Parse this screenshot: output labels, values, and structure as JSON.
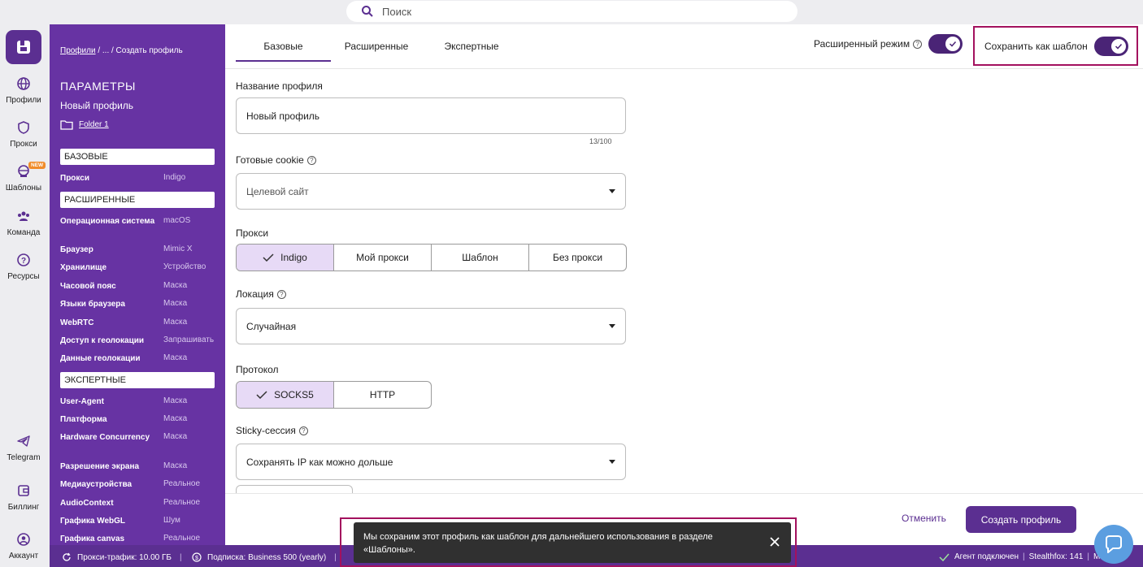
{
  "search": {
    "placeholder": "Поиск"
  },
  "nav": {
    "items": [
      {
        "label": "Профили"
      },
      {
        "label": "Прокси"
      },
      {
        "label": "Шаблоны",
        "badge": "NEW"
      },
      {
        "label": "Команда"
      },
      {
        "label": "Ресурсы"
      },
      {
        "label": "Telegram"
      },
      {
        "label": "Биллинг"
      },
      {
        "label": "Аккаунт"
      }
    ]
  },
  "params": {
    "breadcrumb_link": "Профили",
    "breadcrumb_rest": " / ... / Создать профиль",
    "title": "ПАРАМЕТРЫ",
    "profile_name": "Новый профиль",
    "folder": "Folder 1",
    "sections": {
      "basic": "БАЗОВЫЕ",
      "advanced": "РАСШИРЕННЫЕ",
      "expert": "ЭКСПЕРТНЫЕ"
    },
    "basic_rows": [
      {
        "k": "Прокси",
        "v": "Indigo"
      }
    ],
    "advanced_rows": [
      {
        "k": "Операционная система",
        "v": "macOS"
      },
      {
        "k": "Браузер",
        "v": "Mimic X"
      },
      {
        "k": "Хранилище",
        "v": "Устройство"
      },
      {
        "k": "Часовой пояс",
        "v": "Маска"
      },
      {
        "k": "Языки браузера",
        "v": "Маска"
      },
      {
        "k": "WebRTC",
        "v": "Маска"
      },
      {
        "k": "Доступ к геолокации",
        "v": "Запрашивать"
      },
      {
        "k": "Данные геолокации",
        "v": "Маска"
      }
    ],
    "expert_rows": [
      {
        "k": "User-Agent",
        "v": "Маска"
      },
      {
        "k": "Платформа",
        "v": "Маска"
      },
      {
        "k": "Hardware Concurrency",
        "v": "Маска"
      },
      {
        "k": "Разрешение экрана",
        "v": "Маска"
      },
      {
        "k": "Медиаустройства",
        "v": "Реальное"
      },
      {
        "k": "AudioContext",
        "v": "Реальное"
      },
      {
        "k": "Графика WebGL",
        "v": "Шум"
      },
      {
        "k": "Графика canvas",
        "v": "Реальное"
      }
    ]
  },
  "tabs": [
    "Базовые",
    "Расширенные",
    "Экспертные"
  ],
  "advanced_mode": {
    "label": "Расширенный режим",
    "on": true
  },
  "save_template": {
    "label": "Сохранить как шаблон",
    "on": true
  },
  "form": {
    "name_label": "Название профиля",
    "name_value": "Новый профиль",
    "name_counter": "13/100",
    "cookie_label": "Готовые cookie",
    "cookie_placeholder": "Целевой сайт",
    "proxy_label": "Прокси",
    "proxy_options": [
      "Indigo",
      "Мой прокси",
      "Шаблон",
      "Без прокси"
    ],
    "proxy_selected": "Indigo",
    "location_label": "Локация",
    "location_value": "Случайная",
    "protocol_label": "Протокол",
    "protocol_options": [
      "SOCKS5",
      "HTTP"
    ],
    "protocol_selected": "SOCKS5",
    "sticky_label": "Sticky-сессия",
    "sticky_value": "Сохранять IP как можно дольше"
  },
  "actions": {
    "cancel": "Отменить",
    "create": "Создать профиль"
  },
  "status": {
    "proxy_traffic": "Прокси-трафик: 10.00 ГБ",
    "subscription": "Подписка: Business 500 (yearly)",
    "agent": "Агент подключен",
    "stealthfox": "Stealthfox: 141",
    "mimic": "M"
  },
  "toast": {
    "text": "Мы сохраним этот профиль как шаблон для дальнейшего использования в разделе «Шаблоны»."
  },
  "colors": {
    "brand": "#5b2f91",
    "panel": "#6733a3",
    "highlight": "#a3115e",
    "selected": "#e7daf6",
    "chat": "#5b9ee0"
  }
}
